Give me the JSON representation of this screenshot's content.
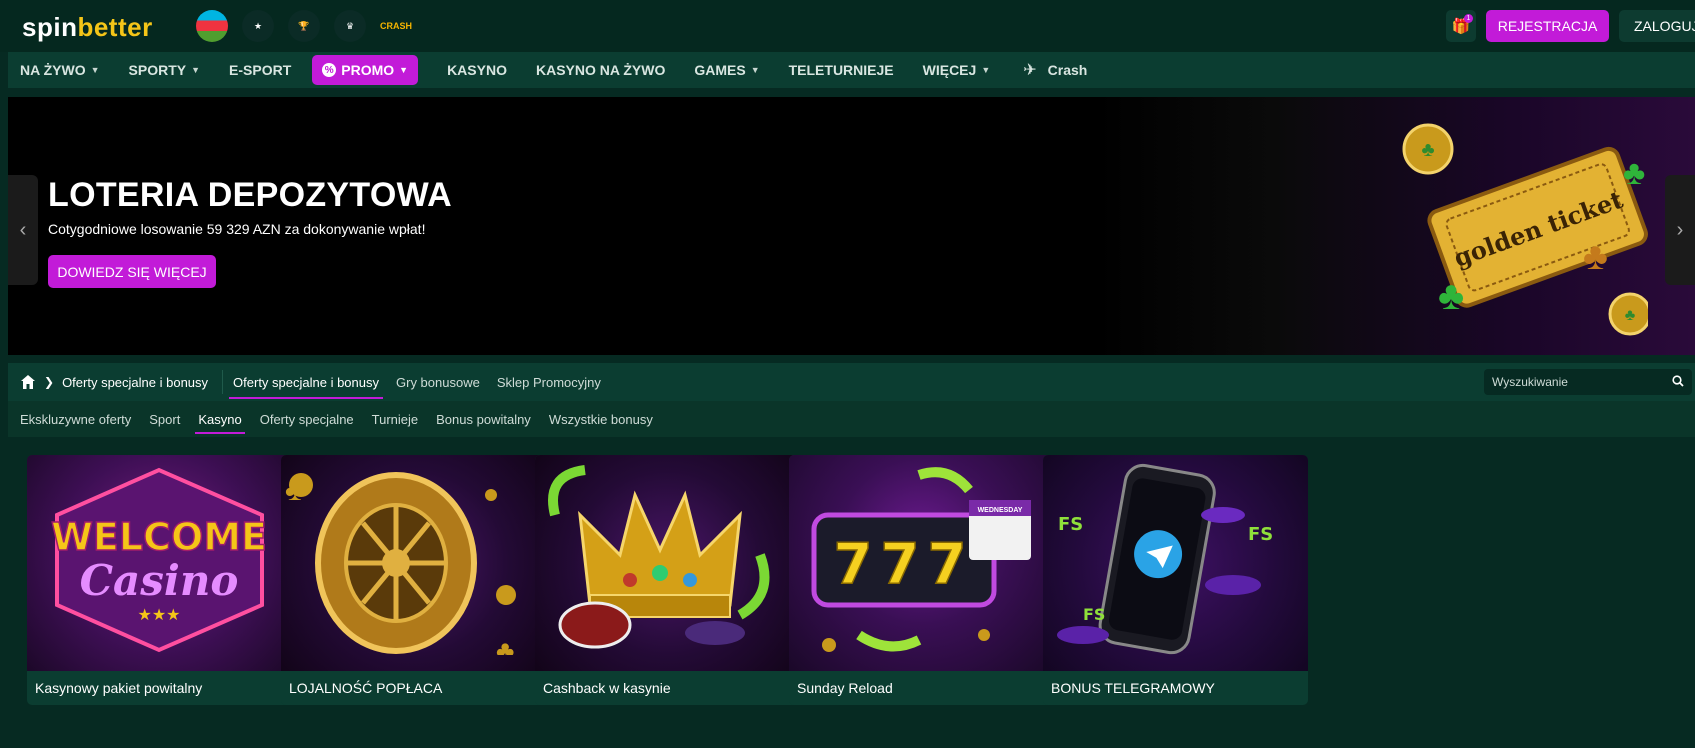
{
  "header": {
    "logo_part1": "spin",
    "logo_part2": "better",
    "league_icons": [
      "azerbaijan-flag",
      "champions-league",
      "europa-league",
      "premier-league",
      "crash"
    ],
    "crash_label": "CRASH",
    "gift_badge": "1",
    "register_label": "REJESTRACJA",
    "login_label": "ZALOGUJ"
  },
  "nav": {
    "items": [
      {
        "label": "NA ŻYWO",
        "dropdown": true
      },
      {
        "label": "SPORTY",
        "dropdown": true
      },
      {
        "label": "E-SPORT",
        "dropdown": false
      },
      {
        "label": "PROMO",
        "dropdown": true,
        "active": true
      },
      {
        "label": "KASYNO",
        "dropdown": false
      },
      {
        "label": "KASYNO NA ŻYWO",
        "dropdown": false
      },
      {
        "label": "GAMES",
        "dropdown": true
      },
      {
        "label": "TELETURNIEJE",
        "dropdown": false
      },
      {
        "label": "WIĘCEJ",
        "dropdown": true
      }
    ],
    "crash_label": "Crash"
  },
  "banner": {
    "title": "LOTERIA DEPOZYTOWA",
    "subtitle": "Cotygodniowe losowanie 59 329 AZN za dokonywanie wpłat!",
    "cta_label": "DOWIEDZ SIĘ WIĘCEJ",
    "image_text": "golden ticket"
  },
  "breadcrumb": {
    "current": "Oferty specjalne i bonusy"
  },
  "tabs": [
    {
      "label": "Oferty specjalne i bonusy",
      "active": true
    },
    {
      "label": "Gry bonusowe",
      "active": false
    },
    {
      "label": "Sklep Promocyjny",
      "active": false
    }
  ],
  "search": {
    "placeholder": "Wyszukiwanie"
  },
  "subtabs": [
    {
      "label": "Ekskluzywne oferty",
      "active": false
    },
    {
      "label": "Sport",
      "active": false
    },
    {
      "label": "Kasyno",
      "active": true
    },
    {
      "label": "Oferty specjalne",
      "active": false
    },
    {
      "label": "Turnieje",
      "active": false
    },
    {
      "label": "Bonus powitalny",
      "active": false
    },
    {
      "label": "Wszystkie bonusy",
      "active": false
    }
  ],
  "cards": [
    {
      "title": "Kasynowy pakiet powitalny",
      "image_text_1": "WELCOME",
      "image_text_2": "Casino"
    },
    {
      "title": "LOJALNOŚĆ POPŁACA"
    },
    {
      "title": "Cashback w kasynie"
    },
    {
      "title": "Sunday Reload",
      "image_text_1": "777",
      "image_text_2": "WEDNESDAY"
    },
    {
      "title": "BONUS TELEGRAMOWY",
      "image_text_1": "FS"
    }
  ],
  "colors": {
    "accent": "#c21bd8",
    "bg": "#062a22",
    "panel": "#0b3d31"
  }
}
